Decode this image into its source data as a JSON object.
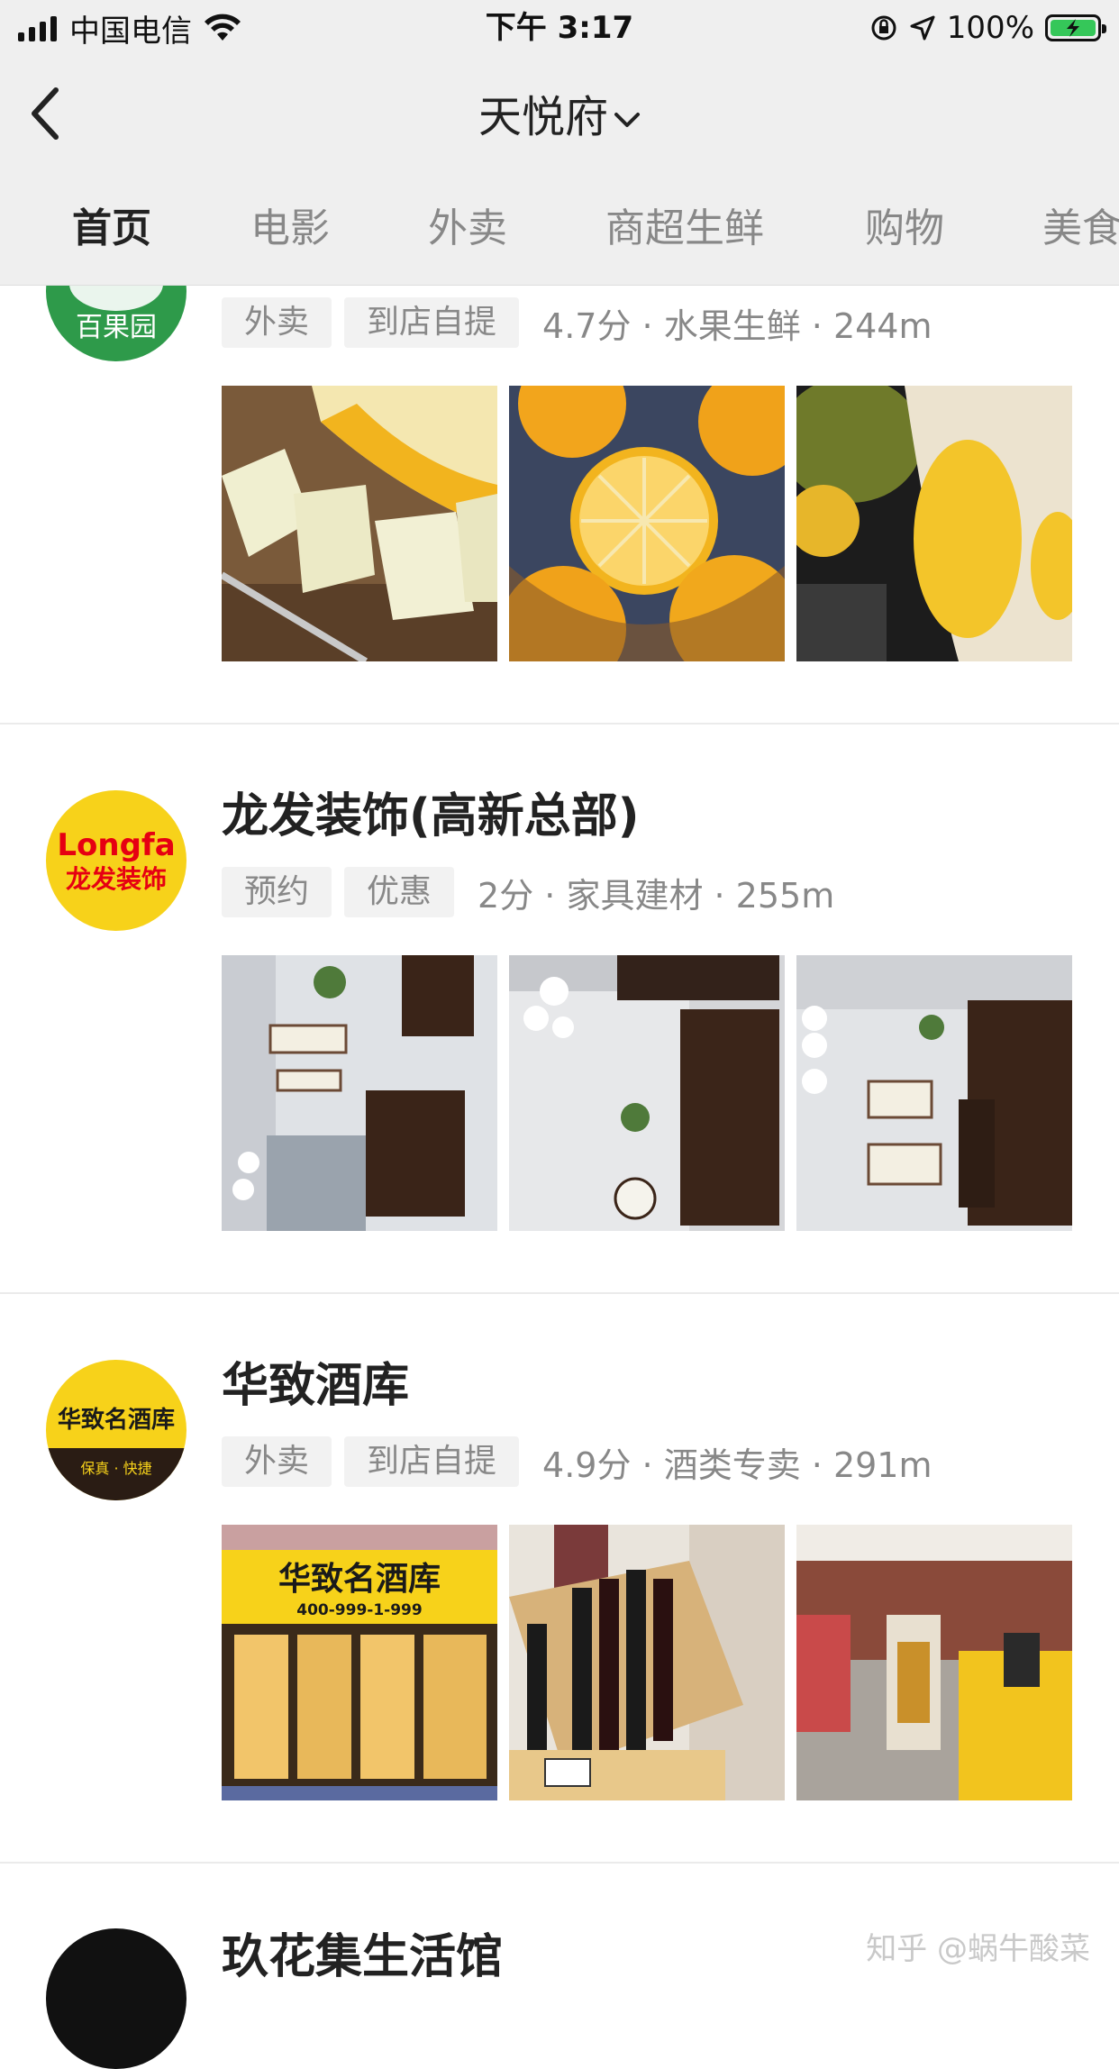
{
  "status_bar": {
    "carrier": "中国电信",
    "time": "下午 3:17",
    "battery": "100%"
  },
  "nav": {
    "location": "天悦府"
  },
  "tabs": [
    {
      "label": "首页",
      "active": true
    },
    {
      "label": "电影",
      "active": false
    },
    {
      "label": "外卖",
      "active": false
    },
    {
      "label": "商超生鲜",
      "active": false
    },
    {
      "label": "购物",
      "active": false
    },
    {
      "label": "美食",
      "active": false
    }
  ],
  "shops": [
    {
      "name": "",
      "logo_text": "百果园",
      "tags": [
        "外卖",
        "到店自提"
      ],
      "meta": "4.7分 · 水果生鲜 · 244m",
      "photos": [
        "melon-photo",
        "orange-photo",
        "durian-photo"
      ]
    },
    {
      "name": "龙发装饰(高新总部)",
      "logo_text": "Longfa",
      "logo_sub": "龙发装饰",
      "tags": [
        "预约",
        "优惠"
      ],
      "meta": "2分 · 家具建材 · 255m",
      "photos": [
        "interior-photo",
        "interior-photo",
        "interior-photo"
      ]
    },
    {
      "name": "华致酒库",
      "logo_text": "华致名酒库",
      "logo_sub": "保真 · 快捷",
      "tags": [
        "外卖",
        "到店自提"
      ],
      "meta": "4.9分 · 酒类专卖 · 291m",
      "photos": [
        "storefront-photo",
        "wine-bottles-photo",
        "store-interior-photo"
      ],
      "storefront_sign": "华致名酒库",
      "storefront_phone": "400-999-1-999"
    },
    {
      "name": "玖花集生活馆"
    }
  ],
  "watermark": "知乎 @蜗牛酸菜",
  "colors": {
    "header_bg": "#efefef",
    "tag_bg": "#f2f2f2",
    "logo_green": "#2e9a4a",
    "logo_yellow": "#f7d21a",
    "logo_red": "#e60012"
  }
}
